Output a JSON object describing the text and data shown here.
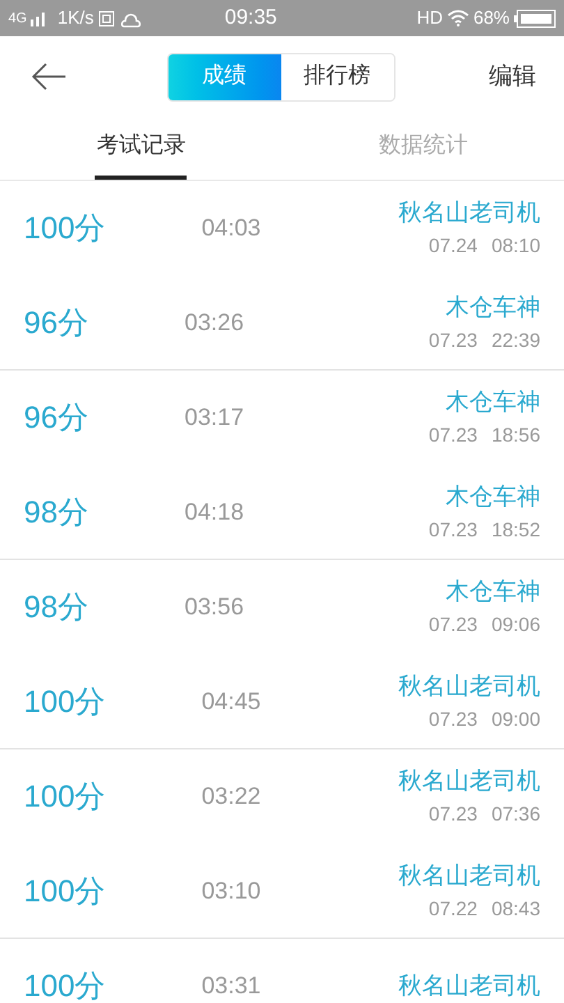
{
  "status_bar": {
    "network": "4G",
    "speed": "1K/s",
    "time": "09:35",
    "hd": "HD",
    "battery": "68%"
  },
  "header": {
    "segments": [
      {
        "label": "成绩",
        "selected": true
      },
      {
        "label": "排行榜",
        "selected": false
      }
    ],
    "action": "编辑"
  },
  "tabs": [
    {
      "label": "考试记录",
      "selected": true
    },
    {
      "label": "数据统计",
      "selected": false
    }
  ],
  "records": [
    {
      "score": "100分",
      "duration": "04:03",
      "name": "秋名山老司机",
      "date": "07.24",
      "time": "08:10",
      "divider_below": false
    },
    {
      "score": "96分",
      "duration": "03:26",
      "name": "木仓车神",
      "date": "07.23",
      "time": "22:39",
      "divider_below": true
    },
    {
      "score": "96分",
      "duration": "03:17",
      "name": "木仓车神",
      "date": "07.23",
      "time": "18:56",
      "divider_below": false
    },
    {
      "score": "98分",
      "duration": "04:18",
      "name": "木仓车神",
      "date": "07.23",
      "time": "18:52",
      "divider_below": true
    },
    {
      "score": "98分",
      "duration": "03:56",
      "name": "木仓车神",
      "date": "07.23",
      "time": "09:06",
      "divider_below": false
    },
    {
      "score": "100分",
      "duration": "04:45",
      "name": "秋名山老司机",
      "date": "07.23",
      "time": "09:00",
      "divider_below": true
    },
    {
      "score": "100分",
      "duration": "03:22",
      "name": "秋名山老司机",
      "date": "07.23",
      "time": "07:36",
      "divider_below": false
    },
    {
      "score": "100分",
      "duration": "03:10",
      "name": "秋名山老司机",
      "date": "07.22",
      "time": "08:43",
      "divider_below": true
    },
    {
      "score": "100分",
      "duration": "03:31",
      "name": "秋名山老司机"
    }
  ]
}
